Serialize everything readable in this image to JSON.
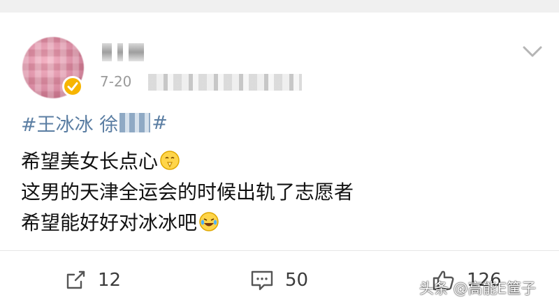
{
  "post": {
    "date": "7-20",
    "topic_prefix": "#王冰冰 徐",
    "topic_suffix": "#",
    "lines": [
      "希望美女长点心",
      "这男的天津全运会的时候出轨了志愿者",
      "希望能好好对冰冰吧"
    ],
    "emojis": [
      "pray-face-emoji",
      "laugh-cry-emoji"
    ]
  },
  "actions": {
    "repost_count": "12",
    "comment_count": "50",
    "like_count": "126"
  },
  "watermark": "头条 @高能E筐子",
  "colors": {
    "topic": "#5b7ea3",
    "verified": "#f7b500",
    "muted": "#9a9a9a"
  }
}
